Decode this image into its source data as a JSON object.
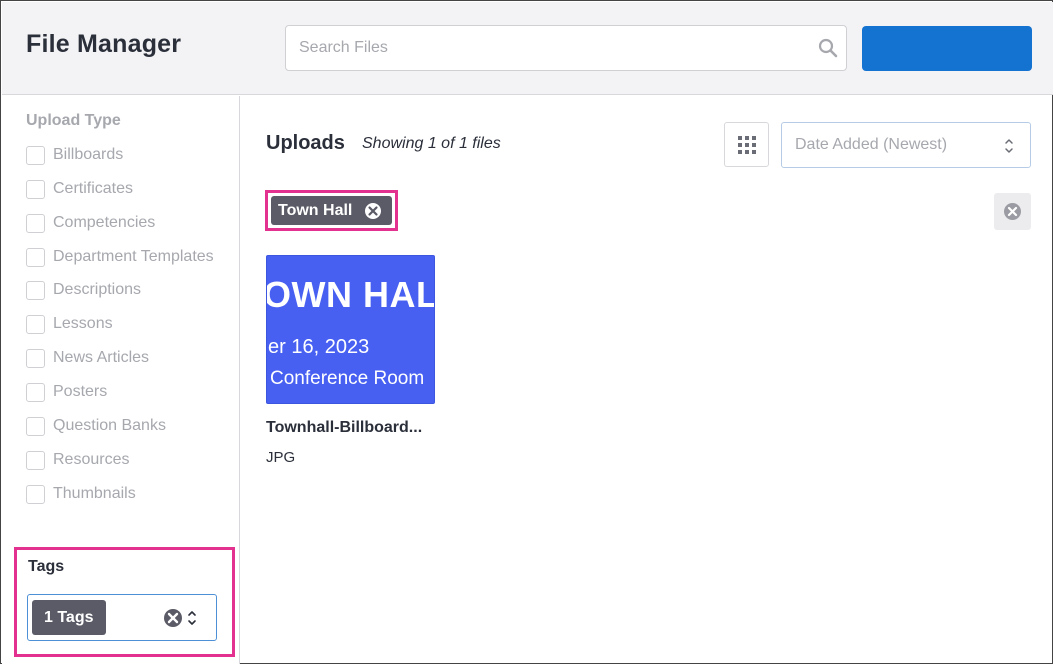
{
  "header": {
    "title": "File Manager",
    "search_placeholder": "Search Files",
    "search_icon": "search-icon",
    "primary_button_label": "",
    "primary_button_color": "#1472d1"
  },
  "sidebar": {
    "upload_type_heading": "Upload Type",
    "upload_types": [
      {
        "label": "Billboards",
        "checked": false
      },
      {
        "label": "Certificates",
        "checked": false
      },
      {
        "label": "Competencies",
        "checked": false
      },
      {
        "label": "Department Templates",
        "checked": false
      },
      {
        "label": "Descriptions",
        "checked": false
      },
      {
        "label": "Lessons",
        "checked": false
      },
      {
        "label": "News Articles",
        "checked": false
      },
      {
        "label": "Posters",
        "checked": false
      },
      {
        "label": "Question Banks",
        "checked": false
      },
      {
        "label": "Resources",
        "checked": false
      },
      {
        "label": "Thumbnails",
        "checked": false
      }
    ],
    "tags_heading": "Tags",
    "tags_selected_label": "1 Tags"
  },
  "main": {
    "title": "Uploads",
    "showing_text": "Showing 1 of 1 files",
    "sort_selected": "Date Added (Newest)",
    "active_filters": [
      {
        "label": "Town Hall"
      }
    ],
    "files": [
      {
        "name": "Townhall-Billboard...",
        "type": "JPG",
        "thumbnail_lines": [
          "OWN HAL",
          "er 16, 2023",
          " Conference Room"
        ],
        "thumbnail_color": "#4860f2"
      }
    ]
  },
  "colors": {
    "highlight": "#e2318e",
    "chip": "#5a5b66",
    "accent": "#1472d1"
  }
}
